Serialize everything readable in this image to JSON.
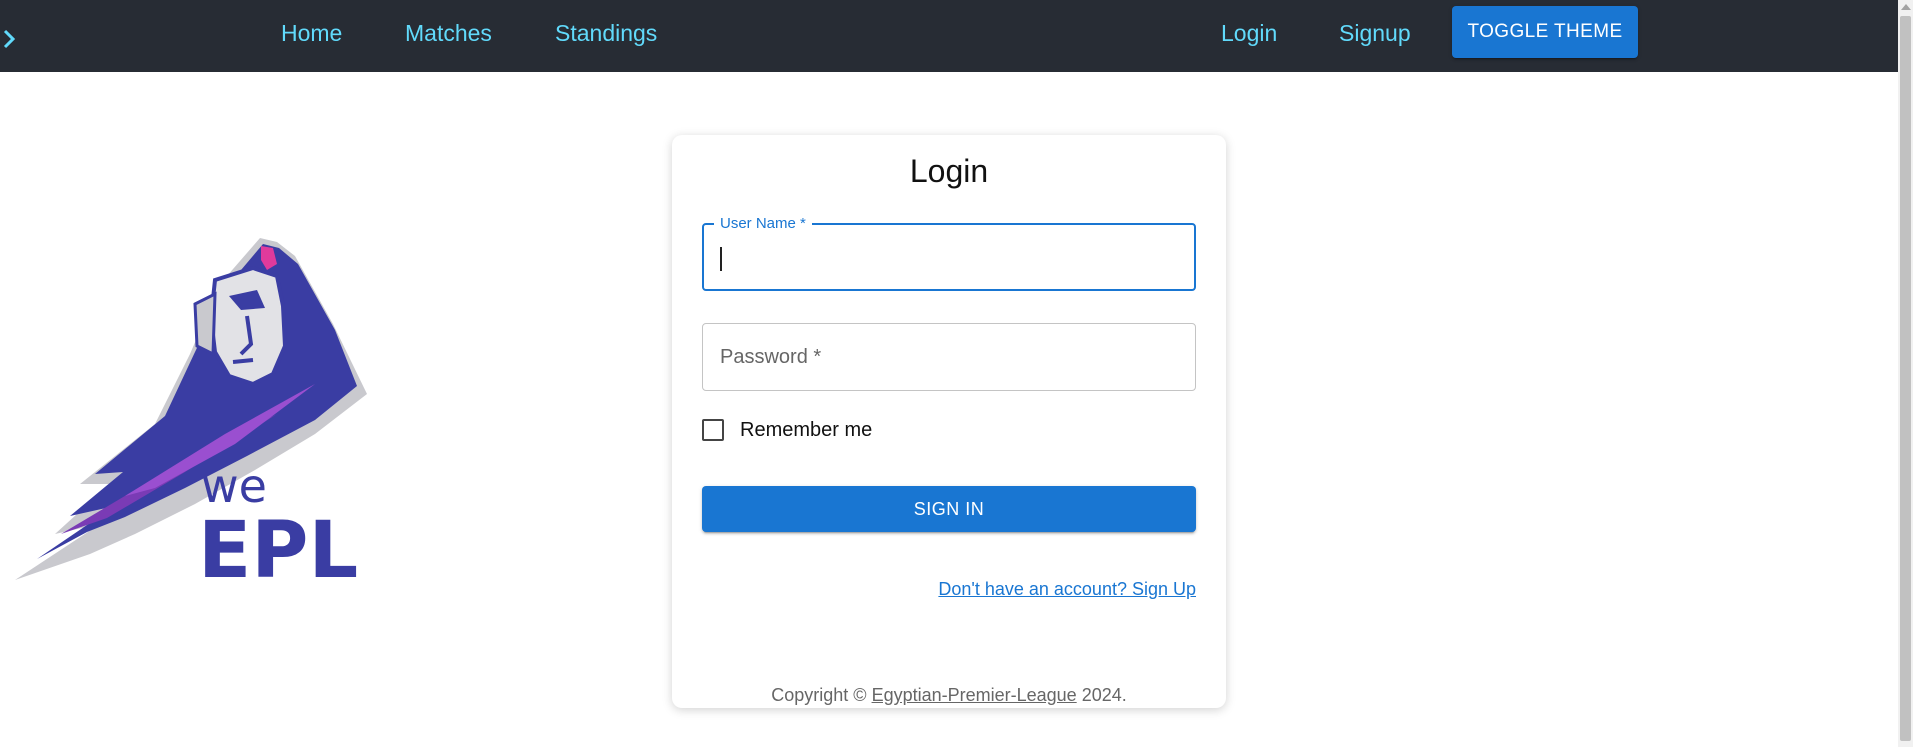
{
  "nav": {
    "links": [
      "Home",
      "Matches",
      "Standings"
    ],
    "auth_links": [
      "Login",
      "Signup"
    ],
    "theme_button": "TOGGLE THEME",
    "link_color": "#61dafb",
    "background": "#272c34"
  },
  "logo": {
    "text_top": "we",
    "text_bottom": "EPL",
    "color": "#3a3da3"
  },
  "login": {
    "title": "Login",
    "username_label": "User Name *",
    "username_value": "",
    "password_placeholder": "Password *",
    "remember_label": "Remember me",
    "remember_checked": false,
    "submit_label": "SIGN IN",
    "signup_link": "Don't have an account? Sign Up",
    "accent": "#1976d2"
  },
  "footer": {
    "prefix": "Copyright © ",
    "link": "Egyptian-Premier-League",
    "suffix": " 2024."
  }
}
